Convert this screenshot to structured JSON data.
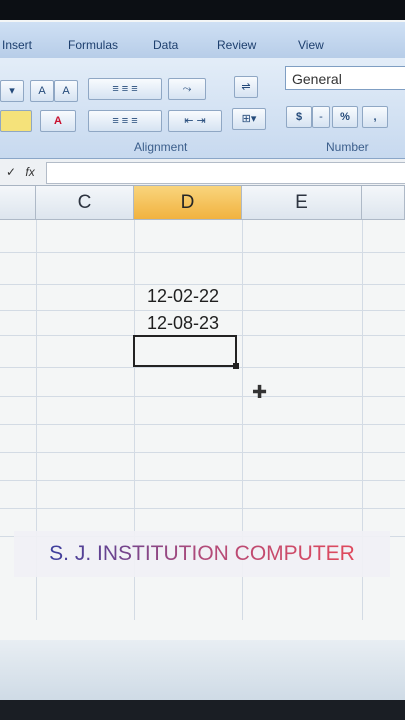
{
  "ribbon": {
    "tabs": [
      "Insert",
      "Formulas",
      "Data",
      "Review",
      "View"
    ],
    "groups": {
      "alignment": "Alignment",
      "number": "Number"
    },
    "number_format": "General",
    "number_buttons": {
      "currency": "$",
      "dash": "-",
      "percent": "%",
      "comma": ","
    }
  },
  "formula_bar": {
    "check": "✓",
    "fx": "fx"
  },
  "columns": [
    "C",
    "D",
    "E"
  ],
  "cells": {
    "d1": "12-02-22",
    "d2": "12-08-23"
  },
  "overlay": {
    "banner_text": "S. J. INSTITUTION COMPUTER"
  },
  "colors": {
    "active_header": "#f1b23f",
    "ribbon_bg": "#c7d9ef"
  }
}
